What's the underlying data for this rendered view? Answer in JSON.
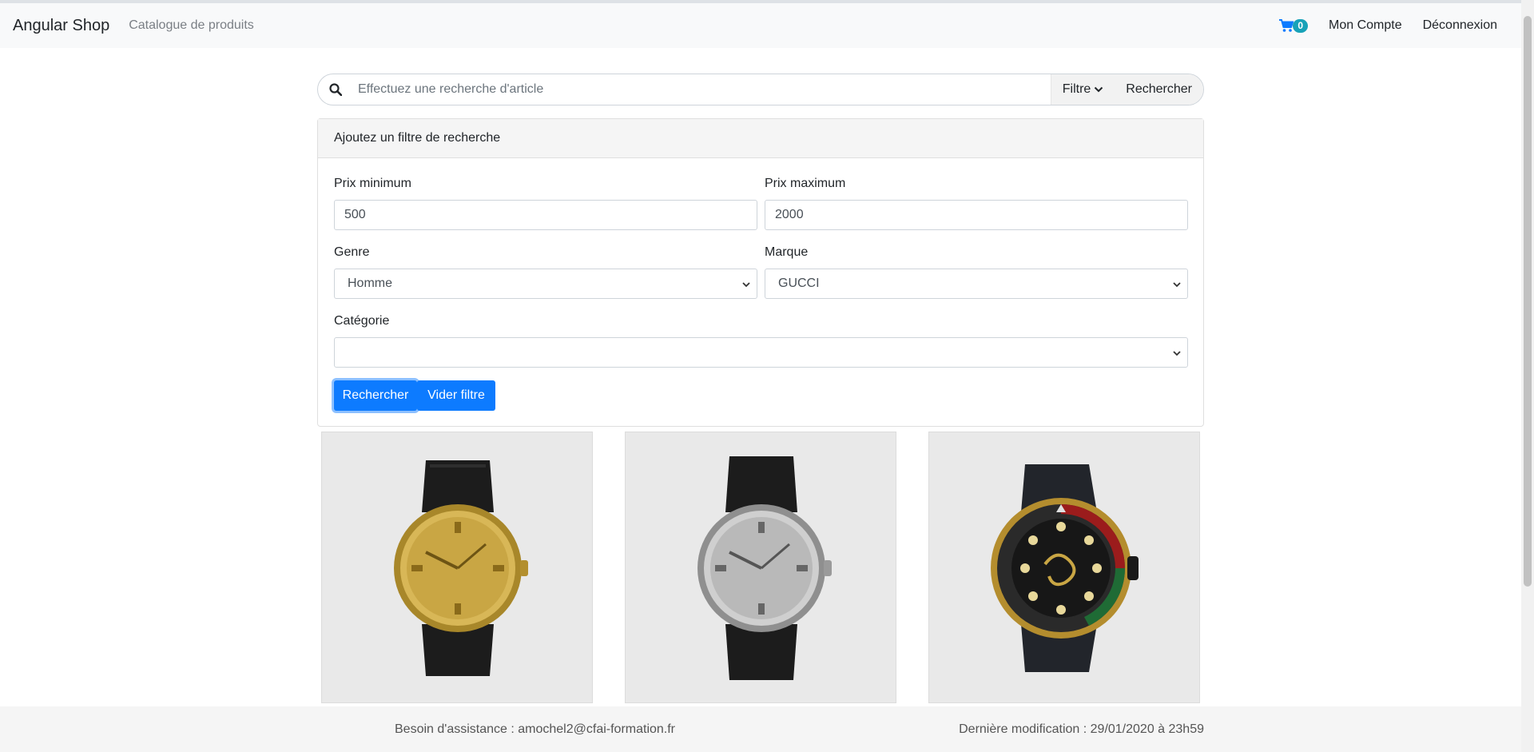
{
  "navbar": {
    "brand": "Angular Shop",
    "catalogue_link": "Catalogue de produits",
    "cart_count": "0",
    "account_link": "Mon Compte",
    "logout_link": "Déconnexion"
  },
  "search": {
    "placeholder": "Effectuez une recherche d'article",
    "filter_label": "Filtre",
    "search_label": "Rechercher"
  },
  "filter_panel": {
    "header": "Ajoutez un filtre de recherche",
    "min_price": {
      "label": "Prix minimum",
      "value": "500"
    },
    "max_price": {
      "label": "Prix maximum",
      "value": "2000"
    },
    "gender": {
      "label": "Genre",
      "value": "Homme"
    },
    "brand": {
      "label": "Marque",
      "value": "GUCCI"
    },
    "category": {
      "label": "Catégorie",
      "value": ""
    },
    "submit_label": "Rechercher",
    "clear_label": "Vider filtre"
  },
  "products": [
    {
      "image": "gold-watch",
      "dial_color": "#c9a644"
    },
    {
      "image": "silver-watch",
      "dial_color": "#b9b9b9"
    },
    {
      "image": "diver-watch",
      "dial_color": "#1a1a1a"
    }
  ],
  "footer": {
    "support": "Besoin d'assistance : amochel2@cfai-formation.fr",
    "last_modified": "Dernière modification : 29/01/2020 à 23h59"
  },
  "colors": {
    "primary": "#0d7bff",
    "badge": "#17a2b8"
  }
}
